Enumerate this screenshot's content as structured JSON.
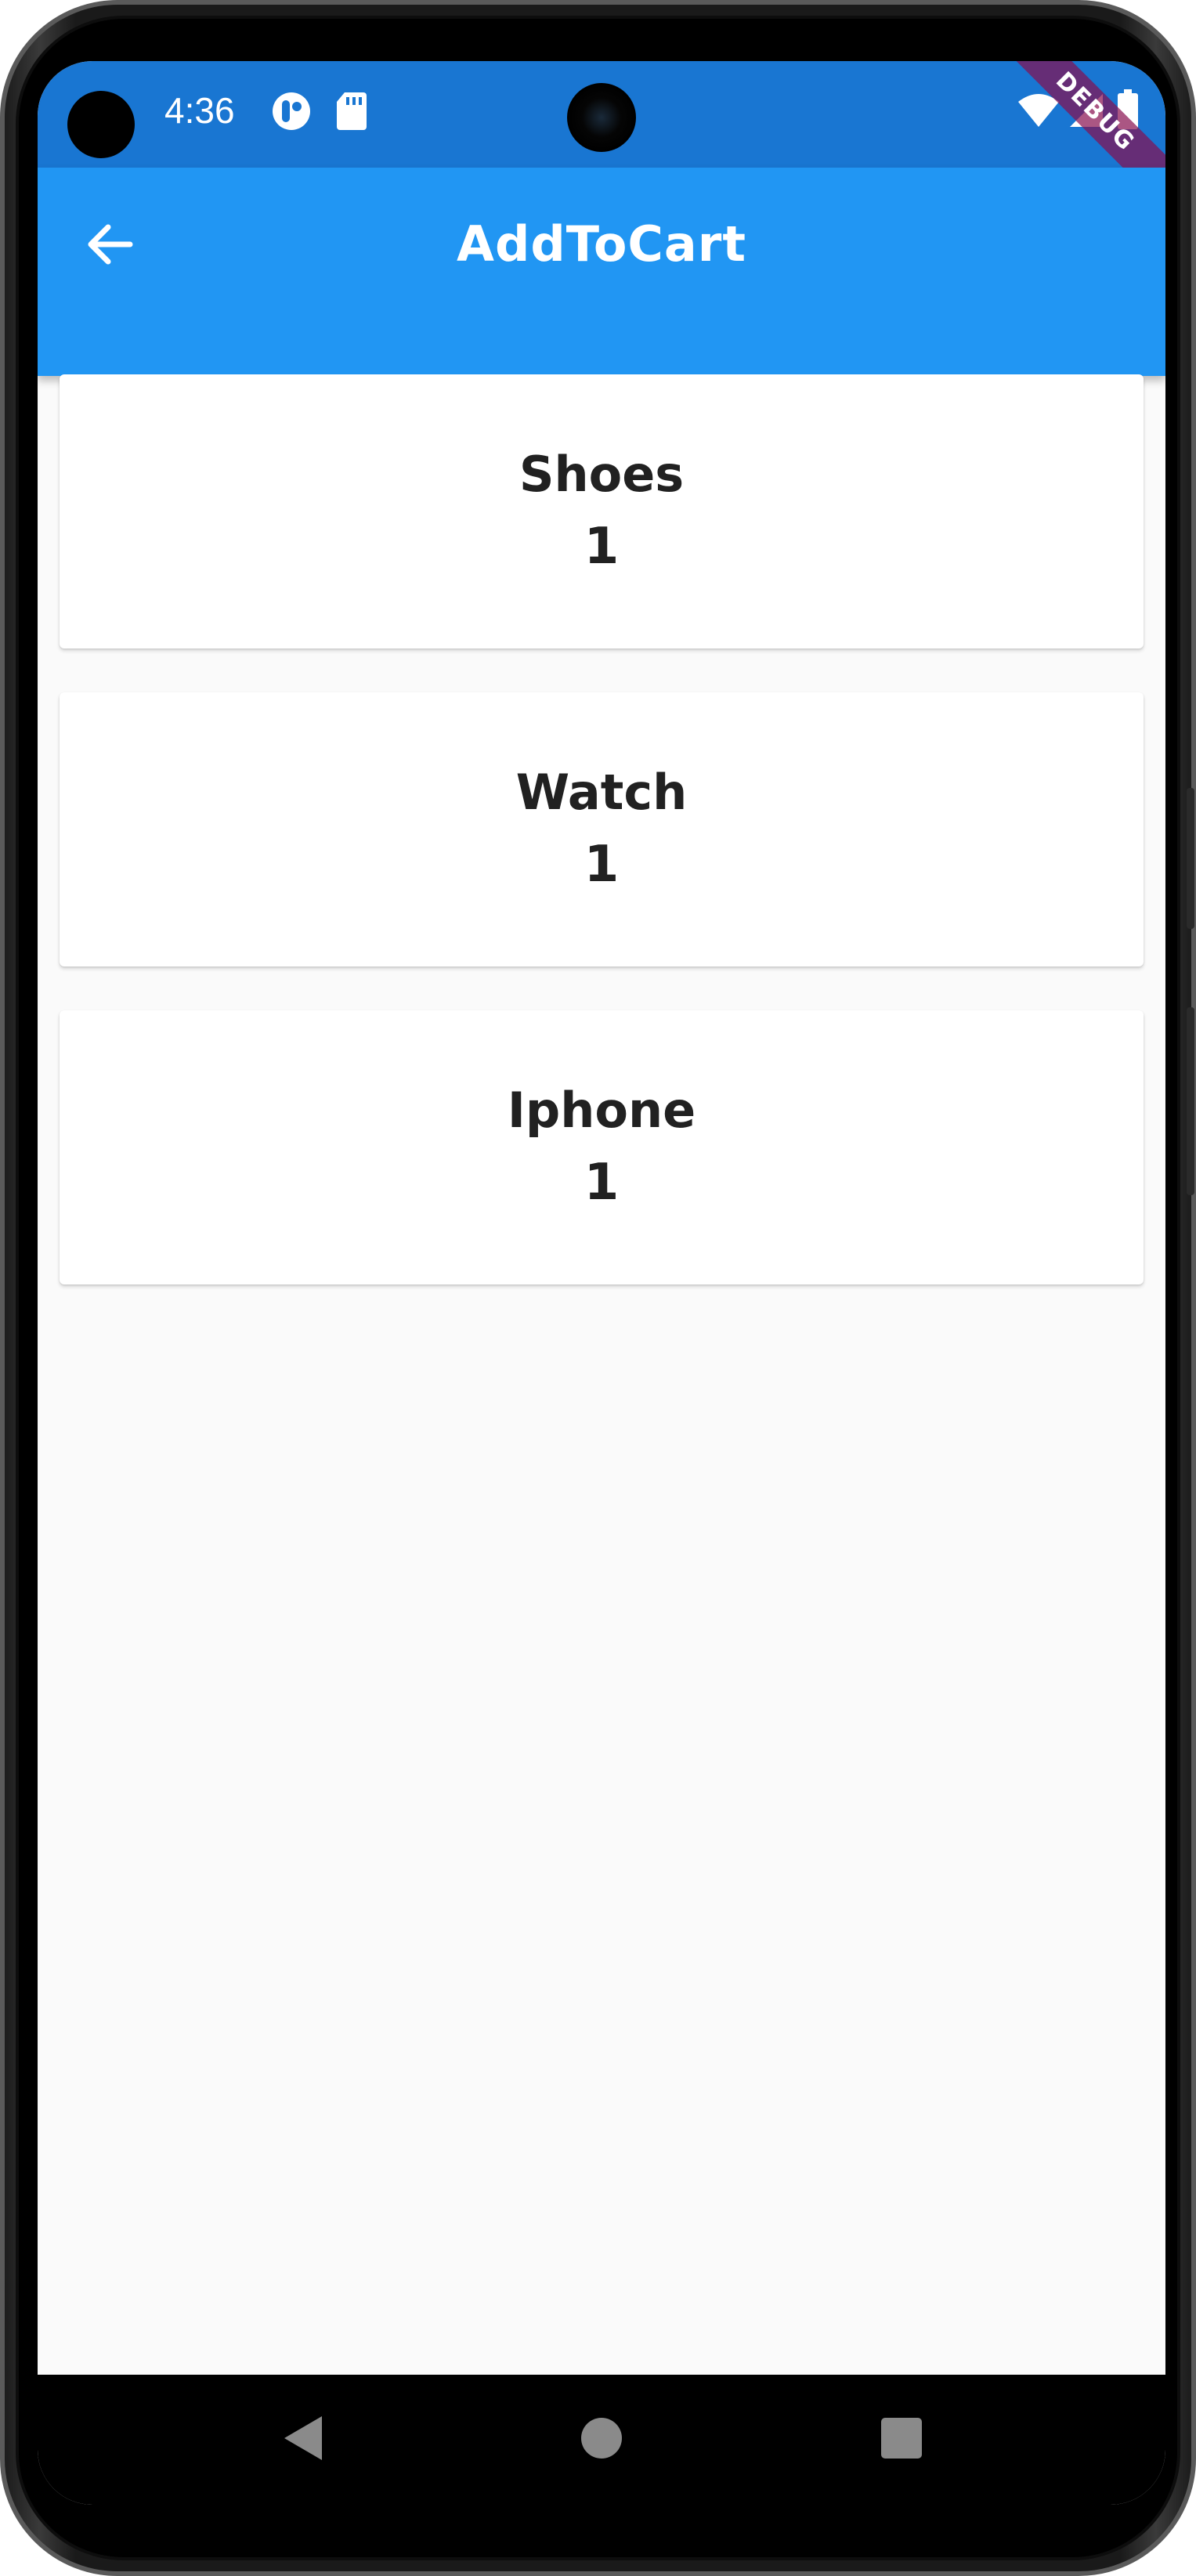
{
  "status_bar": {
    "time": "4:36",
    "icons": [
      "circle-app-icon",
      "sd-card-icon",
      "wifi-icon",
      "signal-icon",
      "battery-icon"
    ]
  },
  "app_bar": {
    "title": "AddToCart",
    "back_icon": "arrow-back-icon",
    "debug_label": "DEBUG"
  },
  "cart": {
    "items": [
      {
        "name": "Shoes",
        "quantity": "1"
      },
      {
        "name": "Watch",
        "quantity": "1"
      },
      {
        "name": "Iphone",
        "quantity": "1"
      }
    ]
  },
  "nav_bar": {
    "buttons": [
      "back-triangle-icon",
      "home-circle-icon",
      "recents-square-icon"
    ]
  },
  "colors": {
    "status_bar": "#1976d2",
    "app_bar": "#2196f3",
    "background": "#fafafa",
    "card": "#ffffff",
    "text": "#212121"
  }
}
